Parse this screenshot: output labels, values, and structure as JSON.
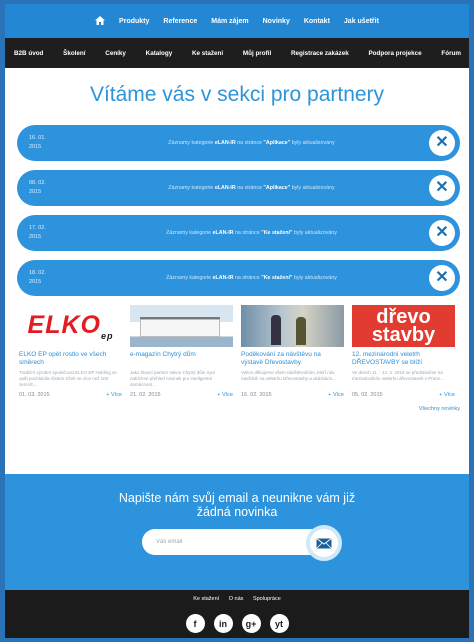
{
  "topnav": {
    "items": [
      "Produkty",
      "Reference",
      "Mám zájem",
      "Novinky",
      "Kontakt",
      "Jak ušetřit"
    ]
  },
  "subnav": {
    "items": [
      "B2B úvod",
      "Školení",
      "Ceníky",
      "Katalogy",
      "Ke stažení",
      "Můj profil",
      "Registrace zakázek",
      "Podpora projekce",
      "Fórum"
    ]
  },
  "page": {
    "title": "Vítáme vás v sekci pro partnery"
  },
  "notices": [
    {
      "date1": "16. 01.",
      "date2": "2015",
      "pre": "Záznamy kategorie ",
      "bold1": "eLAN-IR",
      "mid": " na stránce ",
      "bold2": "\"Aplikace\"",
      "post": " byly aktualizovány"
    },
    {
      "date1": "08. 02.",
      "date2": "2015",
      "pre": "Záznamy kategorie ",
      "bold1": "eLAN-IR",
      "mid": " na stránce ",
      "bold2": "\"Aplikace\"",
      "post": " byly aktualizovány"
    },
    {
      "date1": "17. 02.",
      "date2": "2015",
      "pre": "Záznamy kategorie ",
      "bold1": "eLAN-IR",
      "mid": " na stránce ",
      "bold2": "\"Ke stažení\"",
      "post": " byly aktualizovány"
    },
    {
      "date1": "18. 02.",
      "date2": "2015",
      "pre": "Záznamy kategorie ",
      "bold1": "eLAN-IR",
      "mid": " na stránce ",
      "bold2": "\"Ke stažení\"",
      "post": " byly aktualizovány"
    }
  ],
  "news": [
    {
      "logo_main": "ELKO",
      "logo_ep": "ep",
      "title": "ELKO EP opět rostlo ve všech směrech",
      "excerpt": "Tradiční výrobní společnost ELKO EP Holding se opět pochlubila růstem tržeb ve více než 100 zemích...",
      "date": "01. 03. 2015",
      "more": "+ Více"
    },
    {
      "title": "e-magazín Chytrý dům",
      "excerpt": "Jako hlavní partner sekce Chytrý dům nyní nabízíme přehled novinek pro inteligentní domácnost...",
      "date": "21. 02. 2015",
      "more": "+ Více"
    },
    {
      "title": "Poděkování za návštěvu na výstavě Dřevostavby",
      "excerpt": "Velice děkujeme všem návštěvníkům, kteří nás navštívili na veletrhu Dřevostavby a ukázkách...",
      "date": "16. 02. 2015",
      "more": "+ Více"
    },
    {
      "logo_line1": "dřevo",
      "logo_line2": "stavby",
      "title": "12. mezinárodní veletrh DŘEVOSTAVBY se blíží",
      "excerpt": "Ve dnech 11. - 14. 2. 2015 se představíme na mezinárodním veletrhu dřevostaveb v Praze...",
      "date": "05. 02. 2015",
      "more": "+ Více"
    }
  ],
  "all_news": "Všechny novinky",
  "newsletter": {
    "title_line1": "Napište nám svůj email a neunikne vám již",
    "title_line2": "žádná novinka",
    "placeholder": "Váš email"
  },
  "footer": {
    "links": [
      "Ke stažení",
      "O nás",
      "Spolupráce"
    ],
    "social": [
      "f",
      "in",
      "g+",
      "yt"
    ]
  },
  "colors": {
    "accent": "#2d93dc",
    "title": "#2b95d9",
    "nav_dark": "#1e1e1e",
    "nav_blue": "#2487d3"
  }
}
